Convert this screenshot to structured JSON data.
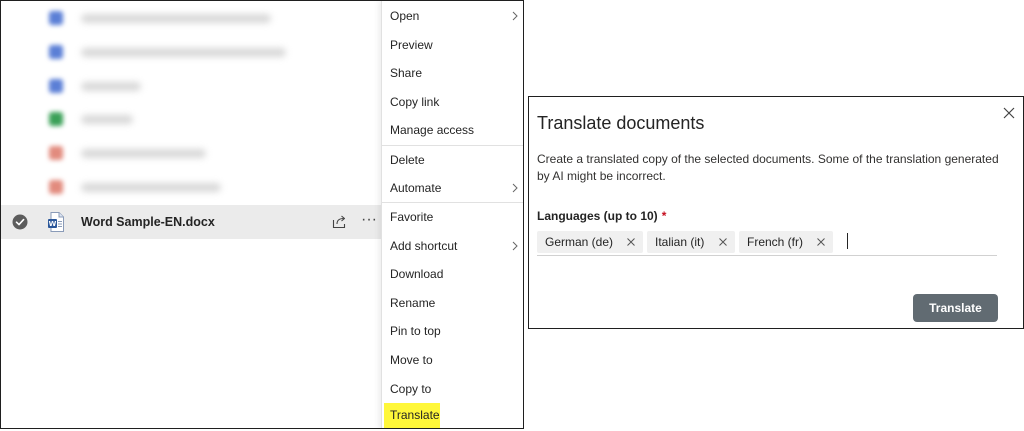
{
  "file_list": {
    "selected_file": {
      "name": "Word Sample-EN.docx",
      "icon": "word-doc-icon",
      "actions": [
        "share-icon",
        "more-options-icon"
      ]
    },
    "blurred_rows_note": "",
    "colors": {
      "selected_row_bg": "#ebebeb",
      "word_blue": "#2b579a"
    }
  },
  "context_menu": {
    "items": [
      {
        "label": "Open",
        "submenu": true
      },
      {
        "label": "Preview",
        "submenu": false
      },
      {
        "label": "Share",
        "submenu": false
      },
      {
        "label": "Copy link",
        "submenu": false
      },
      {
        "label": "Manage access",
        "submenu": false
      },
      {
        "label": "Delete",
        "submenu": false
      },
      {
        "label": "Automate",
        "submenu": true
      },
      {
        "label": "Favorite",
        "submenu": false
      },
      {
        "label": "Add shortcut",
        "submenu": true
      },
      {
        "label": "Download",
        "submenu": false
      },
      {
        "label": "Rename",
        "submenu": false
      },
      {
        "label": "Pin to top",
        "submenu": false
      },
      {
        "label": "Move to",
        "submenu": false
      },
      {
        "label": "Copy to",
        "submenu": false
      },
      {
        "label": "Translate",
        "submenu": false,
        "highlighted": true
      }
    ],
    "highlight_color": "#fff73a"
  },
  "dialog": {
    "title": "Translate documents",
    "description": "Create a translated copy of the selected documents. Some of the translation generated by AI might be incorrect.",
    "languages_label": "Languages (up to 10)",
    "required_marker": "*",
    "languages": [
      {
        "label": "German (de)"
      },
      {
        "label": "Italian (it)"
      },
      {
        "label": "French (fr)"
      }
    ],
    "translate_button": "Translate",
    "close_icon": "close-icon",
    "colors": {
      "button_bg": "#616b72",
      "tag_bg": "#f0f0f0",
      "required": "#c50f1f"
    }
  }
}
